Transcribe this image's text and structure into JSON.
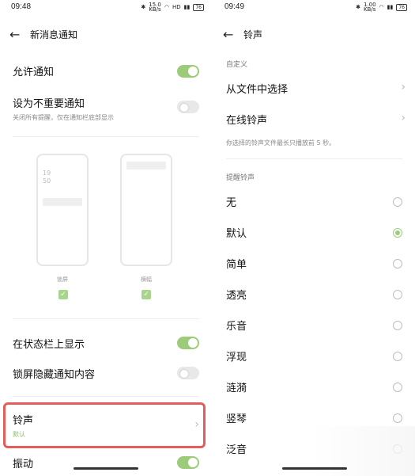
{
  "left": {
    "status": {
      "time": "09:48",
      "net": "15.0\nKB/s",
      "signal1": "HD",
      "signal2": "4G",
      "battery": "76"
    },
    "header": {
      "title": "新消息通知"
    },
    "allow_notify": {
      "label": "允许通知",
      "on": true
    },
    "unimportant": {
      "label": "设为不重要通知",
      "sub": "关闭所有提醒，仅在通知栏底部显示",
      "on": false
    },
    "previews": [
      {
        "label": "锁屏",
        "time": "19\n50",
        "checked": true
      },
      {
        "label": "横幅",
        "checked": true
      }
    ],
    "status_bar": {
      "label": "在状态栏上显示",
      "on": true
    },
    "hide_lock": {
      "label": "锁屏隐藏通知内容",
      "on": false
    },
    "ringtone": {
      "label": "铃声",
      "value": "默认"
    },
    "vibrate": {
      "label": "振动",
      "on": true
    }
  },
  "right": {
    "status": {
      "time": "09:49",
      "net": "1.00\nKB/s",
      "battery": "76"
    },
    "header": {
      "title": "铃声"
    },
    "custom_section": "自定义",
    "from_file": "从文件中选择",
    "online": "在线铃声",
    "note": "你选择的铃声文件最长只播放前 5 秒。",
    "alert_section": "提醒铃声",
    "options": [
      "无",
      "默认",
      "简单",
      "透亮",
      "乐音",
      "浮现",
      "涟漪",
      "竖琴",
      "泛音"
    ],
    "selected_index": 1
  },
  "colors": {
    "accent": "#9ccc7a",
    "highlight": "#e35d5d"
  }
}
